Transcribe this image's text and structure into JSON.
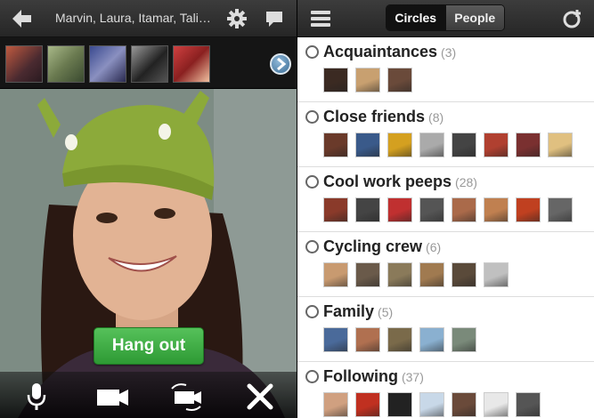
{
  "hangout": {
    "participants": "Marvin, Laura, Itamar, Tali,...",
    "hangout_button": "Hang out",
    "icons": {
      "back": "back-arrow-icon",
      "settings": "gear-icon",
      "chat": "chat-bubble-icon",
      "next": "chevron-right-icon",
      "mic": "microphone-icon",
      "camera": "video-camera-icon",
      "switch_camera": "switch-camera-icon",
      "close": "close-icon"
    },
    "thumbnails": [
      {
        "color": "#7a3b2e"
      },
      {
        "color": "#8a9a6a"
      },
      {
        "color": "#5a6aa0"
      },
      {
        "color": "#333"
      },
      {
        "color": "#b03030"
      }
    ]
  },
  "circles_app": {
    "tabs": [
      {
        "label": "Circles",
        "active": true
      },
      {
        "label": "People",
        "active": false
      }
    ],
    "circles": [
      {
        "name": "Acquaintances",
        "count": "(3)",
        "avatars": [
          "#3b2a22",
          "#c8a070",
          "#6a4a3a"
        ]
      },
      {
        "name": "Close friends",
        "count": "(8)",
        "avatars": [
          "#6a3a2a",
          "#3a5a8a",
          "#d4a020",
          "#aaa",
          "#444",
          "#b04030",
          "#7a3030",
          "#e0c080"
        ]
      },
      {
        "name": "Cool work peeps",
        "count": "(28)",
        "avatars": [
          "#8a3a2a",
          "#444",
          "#c03030",
          "#555",
          "#aa6a4a",
          "#c08050",
          "#c04020",
          "#666"
        ]
      },
      {
        "name": "Cycling crew",
        "count": "(6)",
        "avatars": [
          "#c89a70",
          "#6a5a4a",
          "#8a7a5a",
          "#a07a50",
          "#5a4a3a",
          "#c0c0c0"
        ]
      },
      {
        "name": "Family",
        "count": "(5)",
        "avatars": [
          "#4a6a9a",
          "#b07050",
          "#7a6a4a",
          "#8ab0d0",
          "#7a8a7a"
        ]
      },
      {
        "name": "Following",
        "count": "(37)",
        "avatars": [
          "#d0a080",
          "#c03020",
          "#222",
          "#c8d8e8",
          "#6a4a3a",
          "#e8e8e8",
          "#555"
        ]
      }
    ]
  }
}
